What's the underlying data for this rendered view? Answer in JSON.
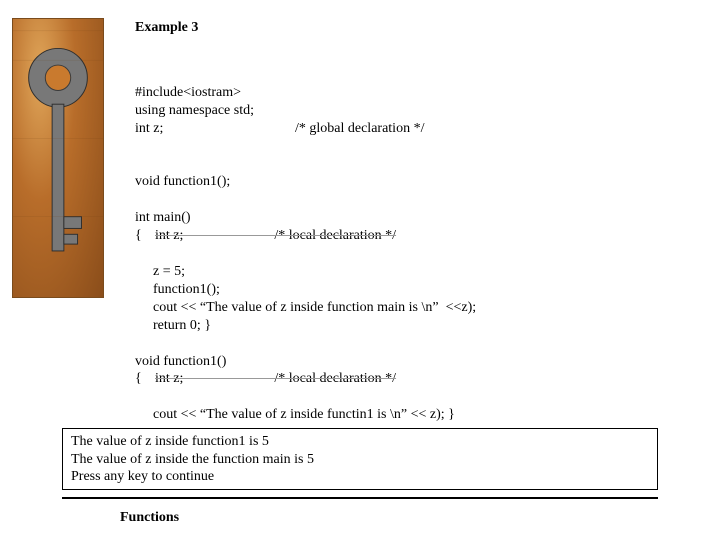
{
  "title": "Example 3",
  "code": {
    "l1": "#include<iostram>",
    "l2": "using namespace std;",
    "l3a": "int z;",
    "l3b": "/* global declaration */",
    "blank1": "",
    "l4": "void function1();",
    "blank2": "",
    "l5": "int main()",
    "l6a": "{",
    "l6b": "int z;                          /* local declaration */",
    "l7": "z = 5;",
    "l8": "function1();",
    "l9": "cout << “The value of z inside function main is \\n”  <<z);",
    "l10": "return 0; }",
    "blank3": "",
    "l11": "void function1()",
    "l12a": "{",
    "l12b": "int z;                          /* local declaration */",
    "l13": "cout << “The value of z inside functin1 is \\n” << z); }"
  },
  "output": {
    "o1": "The value of z inside function1 is 5",
    "o2": "The value of z inside the function main is 5",
    "o3": "Press any key to continue"
  },
  "footer": "Functions"
}
